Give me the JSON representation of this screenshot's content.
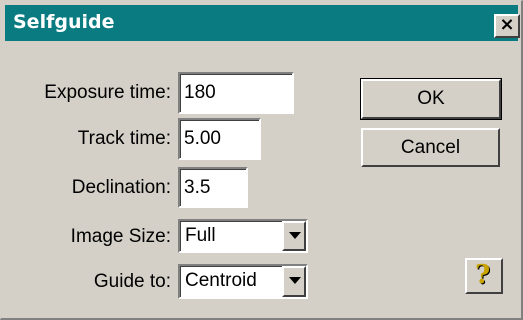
{
  "window": {
    "title": "Selfguide",
    "close_symbol": "×"
  },
  "form": {
    "exposure_time": {
      "label": "Exposure time:",
      "value": "180"
    },
    "track_time": {
      "label": "Track time:",
      "value": "5.00"
    },
    "declination": {
      "label": "Declination:",
      "value": "3.5"
    },
    "image_size": {
      "label": "Image Size:",
      "selected": "Full"
    },
    "guide_to": {
      "label": "Guide to:",
      "selected": "Centroid"
    }
  },
  "buttons": {
    "ok": "OK",
    "cancel": "Cancel",
    "help": "?"
  },
  "colors": {
    "titlebar": "#0a7b80",
    "dialog_bg": "#d4d0c8",
    "help_icon": "#c9a400"
  },
  "icons": {
    "close": "close-icon",
    "dropdown": "chevron-down-icon",
    "help": "help-icon"
  }
}
